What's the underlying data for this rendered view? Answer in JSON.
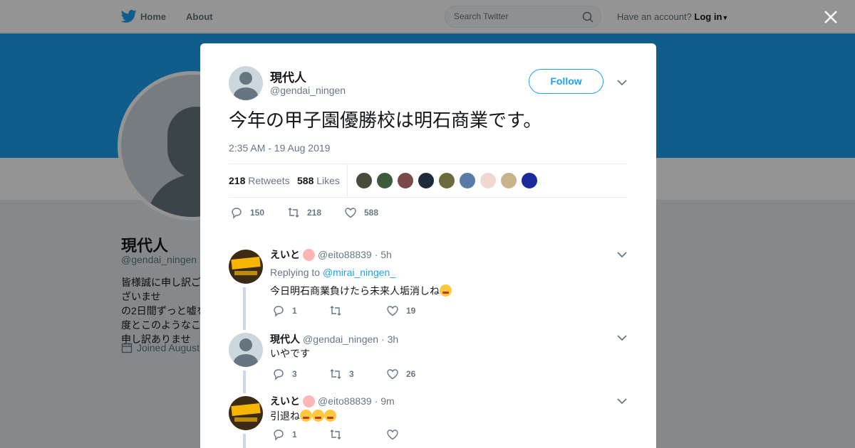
{
  "topbar": {
    "home_label": "Home",
    "about_label": "About",
    "search_placeholder": "Search Twitter",
    "account_prompt": "Have an account?",
    "login_label": "Log in"
  },
  "profile": {
    "name": "現代人",
    "handle": "@gendai_ningen",
    "bio": "皆様誠に申し訳ございませ\nの2日間ずっと嘘を\n度とこのようなこ\n申し訳ありませ",
    "joined": "Joined August"
  },
  "tweet": {
    "author_name": "現代人",
    "author_handle": "@gendai_ningen",
    "follow_label": "Follow",
    "text": "今年の甲子園優勝校は明石商業です。",
    "timestamp": "2:35 AM - 19 Aug 2019",
    "retweets_count": "218",
    "retweets_label": "Retweets",
    "likes_count": "588",
    "likes_label": "Likes",
    "replies_action": "150",
    "retweets_action": "218",
    "likes_action": "588",
    "liker_colors": [
      "#4a4a3a",
      "#3d5a3a",
      "#7a4a4a",
      "#1f2a3a",
      "#6b6b3d",
      "#5a7aa8",
      "#f0d8d0",
      "#c8b48a",
      "#1a2a9a"
    ]
  },
  "replies": [
    {
      "name": "えいと",
      "handle": "@eito88839",
      "time": "· 5h",
      "replying_prefix": "Replying to",
      "replying_to": "@mirai_ningen_",
      "text": "今日明石商業負けたら未来人垢消しね",
      "reply_count": "1",
      "retweet_count": "",
      "like_count": "19"
    },
    {
      "name": "現代人",
      "handle": "@gendai_ningen",
      "time": "· 3h",
      "text": "いやです",
      "reply_count": "3",
      "retweet_count": "3",
      "like_count": "26"
    },
    {
      "name": "えいと",
      "handle": "@eito88839",
      "time": "· 9m",
      "text": "引退ね",
      "reply_count": "1",
      "retweet_count": "",
      "like_count": ""
    }
  ],
  "colors": {
    "brand": "#1da1f2",
    "text": "#14171a",
    "secondary_text": "#657786"
  },
  "icons": [
    "twitter-bird-icon",
    "search-icon",
    "caret-down-icon",
    "close-icon",
    "chevron-down-icon",
    "reply-icon",
    "retweet-icon",
    "like-icon",
    "calendar-icon"
  ]
}
